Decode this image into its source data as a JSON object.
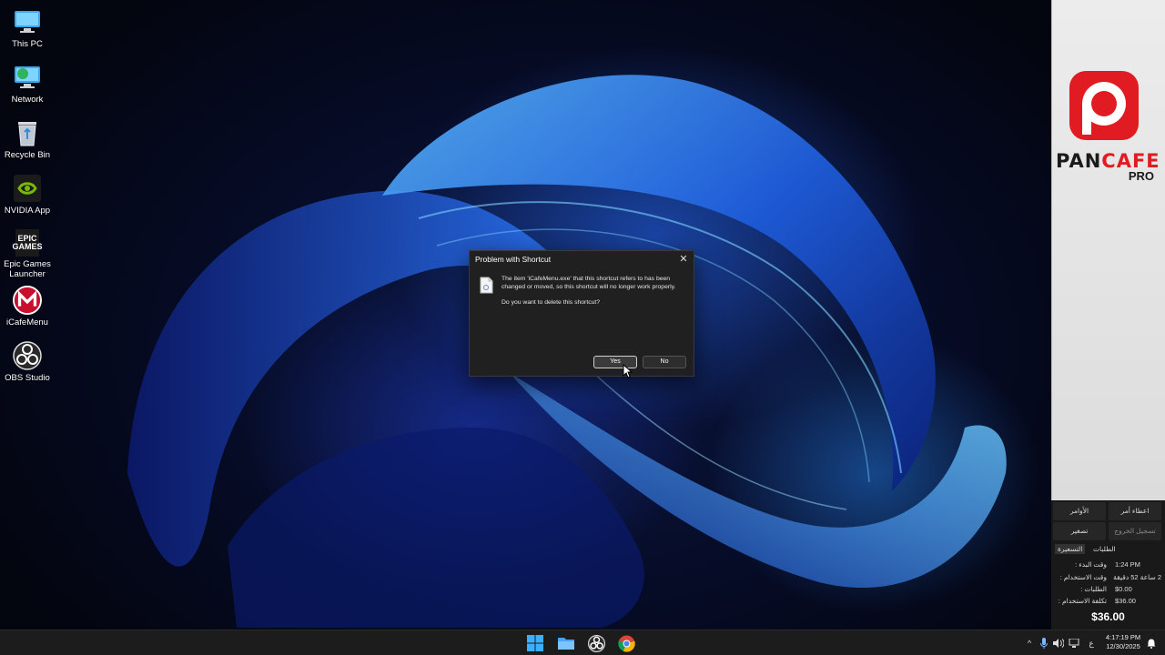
{
  "desktop": {
    "icons": [
      {
        "label": "This PC",
        "icon": "this-pc-icon"
      },
      {
        "label": "Network",
        "icon": "network-icon"
      },
      {
        "label": "Recycle Bin",
        "icon": "recycle-bin-icon"
      },
      {
        "label": "NVIDIA App",
        "icon": "nvidia-icon"
      },
      {
        "label": "Epic Games Launcher",
        "icon": "epic-games-icon",
        "icon_text": "EPIC\nGAMES"
      },
      {
        "label": "iCafeMenu",
        "icon": "icafemenu-icon"
      },
      {
        "label": "OBS Studio",
        "icon": "obs-icon"
      }
    ]
  },
  "dialog": {
    "title": "Problem with Shortcut",
    "message": "The item 'iCafeMenu.exe' that this shortcut refers to has been changed or moved, so this shortcut will no longer work properly.",
    "question": "Do you want to delete this shortcut?",
    "yes_label": "Yes",
    "no_label": "No",
    "close_glyph": "✕"
  },
  "panel": {
    "brand_pan": "PAN",
    "brand_cafe": "CAFE",
    "brand_pro": "PRO",
    "buttons": {
      "commands": "الأوامر",
      "give_order": "اعطاء أمر",
      "minimize": "تصغير",
      "logout": "تسجيل الخروج"
    },
    "tabs": {
      "pricing": "التسعيرة",
      "requests": "الطلبات"
    },
    "info": [
      {
        "label": "وقت البدء :",
        "value": "1:24 PM"
      },
      {
        "label": "وقت الاستخدام :",
        "value": "2 ساعة 52 دقيقة"
      },
      {
        "label": "الطلبات :",
        "value": "$0.00"
      },
      {
        "label": "تكلفة الاستخدام :",
        "value": "$36.00"
      }
    ],
    "total": "$36.00"
  },
  "taskbar": {
    "apps": [
      "windows-start-icon",
      "file-explorer-icon",
      "obs-icon",
      "chrome-icon"
    ],
    "tray": {
      "chevron": "^",
      "lang": "ع",
      "time": "4:17:19 PM",
      "date": "12/30/2025"
    }
  },
  "colors": {
    "brand_red": "#e11b22",
    "panel_dark": "#191919",
    "dialog_bg": "#202020"
  }
}
